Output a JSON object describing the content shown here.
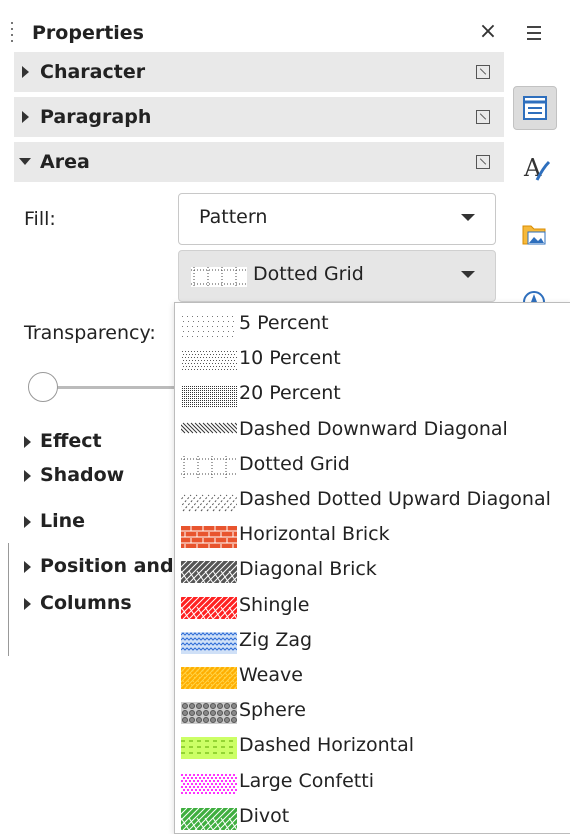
{
  "panel": {
    "title": "Properties",
    "close_glyph": "×",
    "sections": [
      {
        "label": "Character",
        "open": false
      },
      {
        "label": "Paragraph",
        "open": false
      },
      {
        "label": "Area",
        "open": true
      }
    ],
    "area": {
      "fill_label": "Fill:",
      "fill_value": "Pattern",
      "pattern_value": "Dotted Grid",
      "transparency_label": "Transparency:",
      "transparency_value": 0
    },
    "lower_sections": [
      "Effect",
      "Shadow",
      "Line",
      "Position and",
      "Columns"
    ]
  },
  "sidebar": {
    "menu_icon": "hamburger-icon",
    "buttons": [
      {
        "name": "properties-icon",
        "active": true
      },
      {
        "name": "styles-icon",
        "active": false
      },
      {
        "name": "gallery-icon",
        "active": false
      },
      {
        "name": "navigator-icon",
        "active": false
      }
    ]
  },
  "dropdown": {
    "items": [
      {
        "label": "5 Percent",
        "fg": "#777777",
        "bg": "#ffffff",
        "style": "dots-light"
      },
      {
        "label": "10 Percent",
        "fg": "#555555",
        "bg": "#ffffff",
        "style": "dots-medium"
      },
      {
        "label": "20 Percent",
        "fg": "#333333",
        "bg": "#ffffff",
        "style": "dots-dense"
      },
      {
        "label": "Dashed Downward Diagonal",
        "fg": "#333333",
        "bg": "#ffffff",
        "style": "diag-down"
      },
      {
        "label": "Dotted Grid",
        "fg": "#444444",
        "bg": "#ffffff",
        "style": "grid"
      },
      {
        "label": "Dashed Dotted Upward Diagonal",
        "fg": "#555555",
        "bg": "#ffffff",
        "style": "diag-up"
      },
      {
        "label": "Horizontal Brick",
        "fg": "#ffffff",
        "bg": "#e8542e",
        "style": "brick"
      },
      {
        "label": "Diagonal Brick",
        "fg": "#ffffff",
        "bg": "#555555",
        "style": "diag-brick"
      },
      {
        "label": "Shingle",
        "fg": "#ffffff",
        "bg": "#ff2020",
        "style": "shingle"
      },
      {
        "label": "Zig Zag",
        "fg": "#2f6dd6",
        "bg": "#cfe0f7",
        "style": "zigzag"
      },
      {
        "label": "Weave",
        "fg": "#ffd54a",
        "bg": "#ffae00",
        "style": "weave"
      },
      {
        "label": "Sphere",
        "fg": "#666666",
        "bg": "#cccccc",
        "style": "sphere"
      },
      {
        "label": "Dashed Horizontal",
        "fg": "#5aa800",
        "bg": "#ccff66",
        "style": "dash-h"
      },
      {
        "label": "Large Confetti",
        "fg": "#ff33ff",
        "bg": "#ffffff",
        "style": "confetti"
      },
      {
        "label": "Divot",
        "fg": "#ffffff",
        "bg": "#3fae3f",
        "style": "divot"
      }
    ]
  }
}
